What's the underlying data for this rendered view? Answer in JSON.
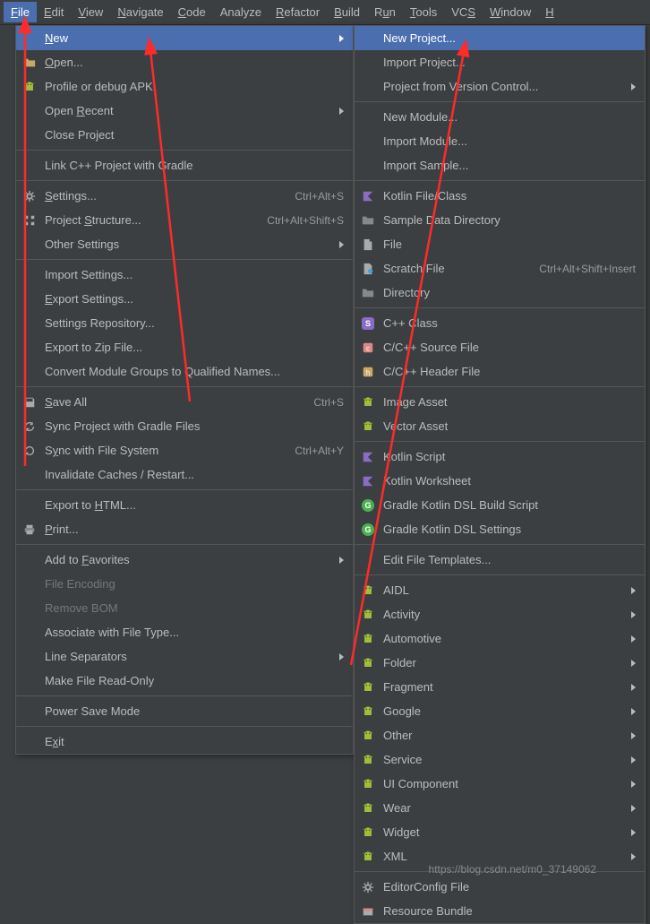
{
  "menubar": [
    {
      "label": "File",
      "ul": 0,
      "active": true
    },
    {
      "label": "Edit",
      "ul": 0
    },
    {
      "label": "View",
      "ul": 0
    },
    {
      "label": "Navigate",
      "ul": 0
    },
    {
      "label": "Code",
      "ul": 0
    },
    {
      "label": "Analyze",
      "ul": -1
    },
    {
      "label": "Refactor",
      "ul": 0
    },
    {
      "label": "Build",
      "ul": 0
    },
    {
      "label": "Run",
      "ul": 1
    },
    {
      "label": "Tools",
      "ul": 0
    },
    {
      "label": "VCS",
      "ul": 2
    },
    {
      "label": "Window",
      "ul": 0
    },
    {
      "label": "H",
      "ul": 0
    }
  ],
  "file_menu": [
    {
      "label": "New",
      "ul": 0,
      "submenu": true,
      "highlighted": true
    },
    {
      "label": "Open...",
      "ul": 0,
      "icon": "folder"
    },
    {
      "label": "Profile or debug APK",
      "icon": "android"
    },
    {
      "label": "Open Recent",
      "ul": 5,
      "submenu": true
    },
    {
      "label": "Close Project"
    },
    {
      "sep": true
    },
    {
      "label": "Link C++ Project with Gradle"
    },
    {
      "sep": true
    },
    {
      "label": "Settings...",
      "ul": 0,
      "icon": "gear",
      "shortcut": "Ctrl+Alt+S"
    },
    {
      "label": "Project Structure...",
      "ul": 8,
      "icon": "struct",
      "shortcut": "Ctrl+Alt+Shift+S"
    },
    {
      "label": "Other Settings",
      "submenu": true
    },
    {
      "sep": true
    },
    {
      "label": "Import Settings..."
    },
    {
      "label": "Export Settings...",
      "ul": 0
    },
    {
      "label": "Settings Repository..."
    },
    {
      "label": "Export to Zip File..."
    },
    {
      "label": "Convert Module Groups to Qualified Names..."
    },
    {
      "sep": true
    },
    {
      "label": "Save All",
      "ul": 0,
      "icon": "save",
      "shortcut": "Ctrl+S"
    },
    {
      "label": "Sync Project with Gradle Files",
      "icon": "sync"
    },
    {
      "label": "Sync with File System",
      "ul": 1,
      "icon": "refresh",
      "shortcut": "Ctrl+Alt+Y"
    },
    {
      "label": "Invalidate Caches / Restart..."
    },
    {
      "sep": true
    },
    {
      "label": "Export to HTML...",
      "ul": 10
    },
    {
      "label": "Print...",
      "ul": 0,
      "icon": "print"
    },
    {
      "sep": true
    },
    {
      "label": "Add to Favorites",
      "ul": 7,
      "submenu": true
    },
    {
      "label": "File Encoding",
      "disabled": true
    },
    {
      "label": "Remove BOM",
      "disabled": true
    },
    {
      "label": "Associate with File Type..."
    },
    {
      "label": "Line Separators",
      "submenu": true
    },
    {
      "label": "Make File Read-Only"
    },
    {
      "sep": true
    },
    {
      "label": "Power Save Mode"
    },
    {
      "sep": true
    },
    {
      "label": "Exit",
      "ul": 1
    }
  ],
  "new_menu": [
    {
      "label": "New Project...",
      "highlighted": true
    },
    {
      "label": "Import Project..."
    },
    {
      "label": "Project from Version Control...",
      "submenu": true
    },
    {
      "sep": true
    },
    {
      "label": "New Module..."
    },
    {
      "label": "Import Module..."
    },
    {
      "label": "Import Sample..."
    },
    {
      "sep": true
    },
    {
      "label": "Kotlin File/Class",
      "icon": "kotlin"
    },
    {
      "label": "Sample Data Directory",
      "icon": "folder-g"
    },
    {
      "label": "File",
      "icon": "file"
    },
    {
      "label": "Scratch File",
      "icon": "scratch",
      "shortcut": "Ctrl+Alt+Shift+Insert"
    },
    {
      "label": "Directory",
      "icon": "folder-g"
    },
    {
      "sep": true
    },
    {
      "label": "C++ Class",
      "icon": "s-badge"
    },
    {
      "label": "C/C++ Source File",
      "icon": "c-src"
    },
    {
      "label": "C/C++ Header File",
      "icon": "c-hdr"
    },
    {
      "sep": true
    },
    {
      "label": "Image Asset",
      "icon": "android"
    },
    {
      "label": "Vector Asset",
      "icon": "android"
    },
    {
      "sep": true
    },
    {
      "label": "Kotlin Script",
      "icon": "kotlin"
    },
    {
      "label": "Kotlin Worksheet",
      "icon": "kotlin"
    },
    {
      "label": "Gradle Kotlin DSL Build Script",
      "icon": "g-badge"
    },
    {
      "label": "Gradle Kotlin DSL Settings",
      "icon": "g-badge"
    },
    {
      "sep": true
    },
    {
      "label": "Edit File Templates..."
    },
    {
      "sep": true
    },
    {
      "label": "AIDL",
      "icon": "android",
      "submenu": true
    },
    {
      "label": "Activity",
      "icon": "android",
      "submenu": true
    },
    {
      "label": "Automotive",
      "icon": "android",
      "submenu": true
    },
    {
      "label": "Folder",
      "icon": "android",
      "submenu": true
    },
    {
      "label": "Fragment",
      "icon": "android",
      "submenu": true
    },
    {
      "label": "Google",
      "icon": "android",
      "submenu": true
    },
    {
      "label": "Other",
      "icon": "android",
      "submenu": true
    },
    {
      "label": "Service",
      "icon": "android",
      "submenu": true
    },
    {
      "label": "UI Component",
      "icon": "android",
      "submenu": true
    },
    {
      "label": "Wear",
      "icon": "android",
      "submenu": true
    },
    {
      "label": "Widget",
      "icon": "android",
      "submenu": true
    },
    {
      "label": "XML",
      "icon": "android",
      "submenu": true
    },
    {
      "sep": true
    },
    {
      "label": "EditorConfig File",
      "icon": "gear"
    },
    {
      "label": "Resource Bundle",
      "icon": "bundle"
    }
  ],
  "watermark": "https://blog.csdn.net/m0_37149062"
}
